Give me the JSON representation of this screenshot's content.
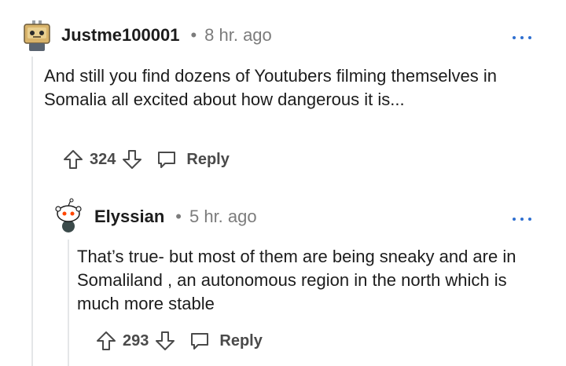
{
  "comments": [
    {
      "username": "Justme100001",
      "separator": "•",
      "time": "8 hr. ago",
      "text": "And still you find dozens of Youtubers filming themselves in Somalia all excited about how dangerous it is...",
      "score": "324",
      "reply_label": "Reply",
      "avatar_icon": "robot-avatar-icon"
    },
    {
      "username": "Elyssian",
      "separator": "•",
      "time": "5 hr. ago",
      "text": "That’s true- but most of them are being sneaky and are in Somaliland , an autonomous region in the north which is much more stable",
      "score": "293",
      "reply_label": "Reply",
      "avatar_icon": "snoo-avatar-icon"
    }
  ],
  "colors": {
    "accent_dots": "#2f6fd0",
    "muted_text": "#7c7c7c",
    "thread_line": "#e4e6e8"
  }
}
